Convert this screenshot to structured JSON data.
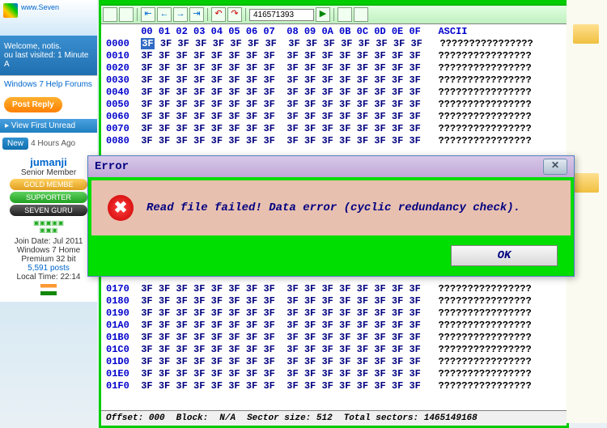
{
  "forum": {
    "site": "www.Seven",
    "welcome": "Welcome, notis.",
    "visited": "ou last visited: 1 Minute A",
    "help_link": "Windows 7 Help Forums",
    "post_reply": "Post Reply",
    "view_first": "▸ View First Unread",
    "new_label": "New",
    "hours_ago": "4 Hours Ago",
    "user": {
      "name": "jumanji",
      "rank": "Senior Member",
      "badge_gold": "GOLD MEMBE",
      "badge_supporter": "SUPPORTER",
      "badge_guru": "SEVEN GURU",
      "join": "Join Date: Jul 2011",
      "os": "Windows 7 Home",
      "os2": "Premium 32 bit",
      "posts": "5,591 posts",
      "local_time": "Local Time: 22:14"
    }
  },
  "hex": {
    "toolbar_input": "416571393",
    "header_cols": "00 01 02 03 04 05 06 07  08 09 0A 0B 0C 0D 0E 0F",
    "header_ascii": "ASCII",
    "hex_val": "3F",
    "ascii_row": "????????????????",
    "offsets_top": [
      "0000",
      "0010",
      "0020",
      "0030",
      "0040",
      "0050",
      "0060",
      "0070",
      "0080"
    ],
    "offsets_bot": [
      "0170",
      "0180",
      "0190",
      "01A0",
      "01B0",
      "01C0",
      "01D0",
      "01E0",
      "01F0"
    ],
    "footer": {
      "offset_l": "Offset:",
      "offset_v": "000",
      "block_l": "Block:",
      "block_v": "N/A",
      "secsize_l": "Sector size:",
      "secsize_v": "512",
      "total_l": "Total sectors:",
      "total_v": "1465149168"
    }
  },
  "dialog": {
    "title": "Error",
    "message": "Read file failed! Data error (cyclic redundancy check).",
    "ok": "OK"
  }
}
